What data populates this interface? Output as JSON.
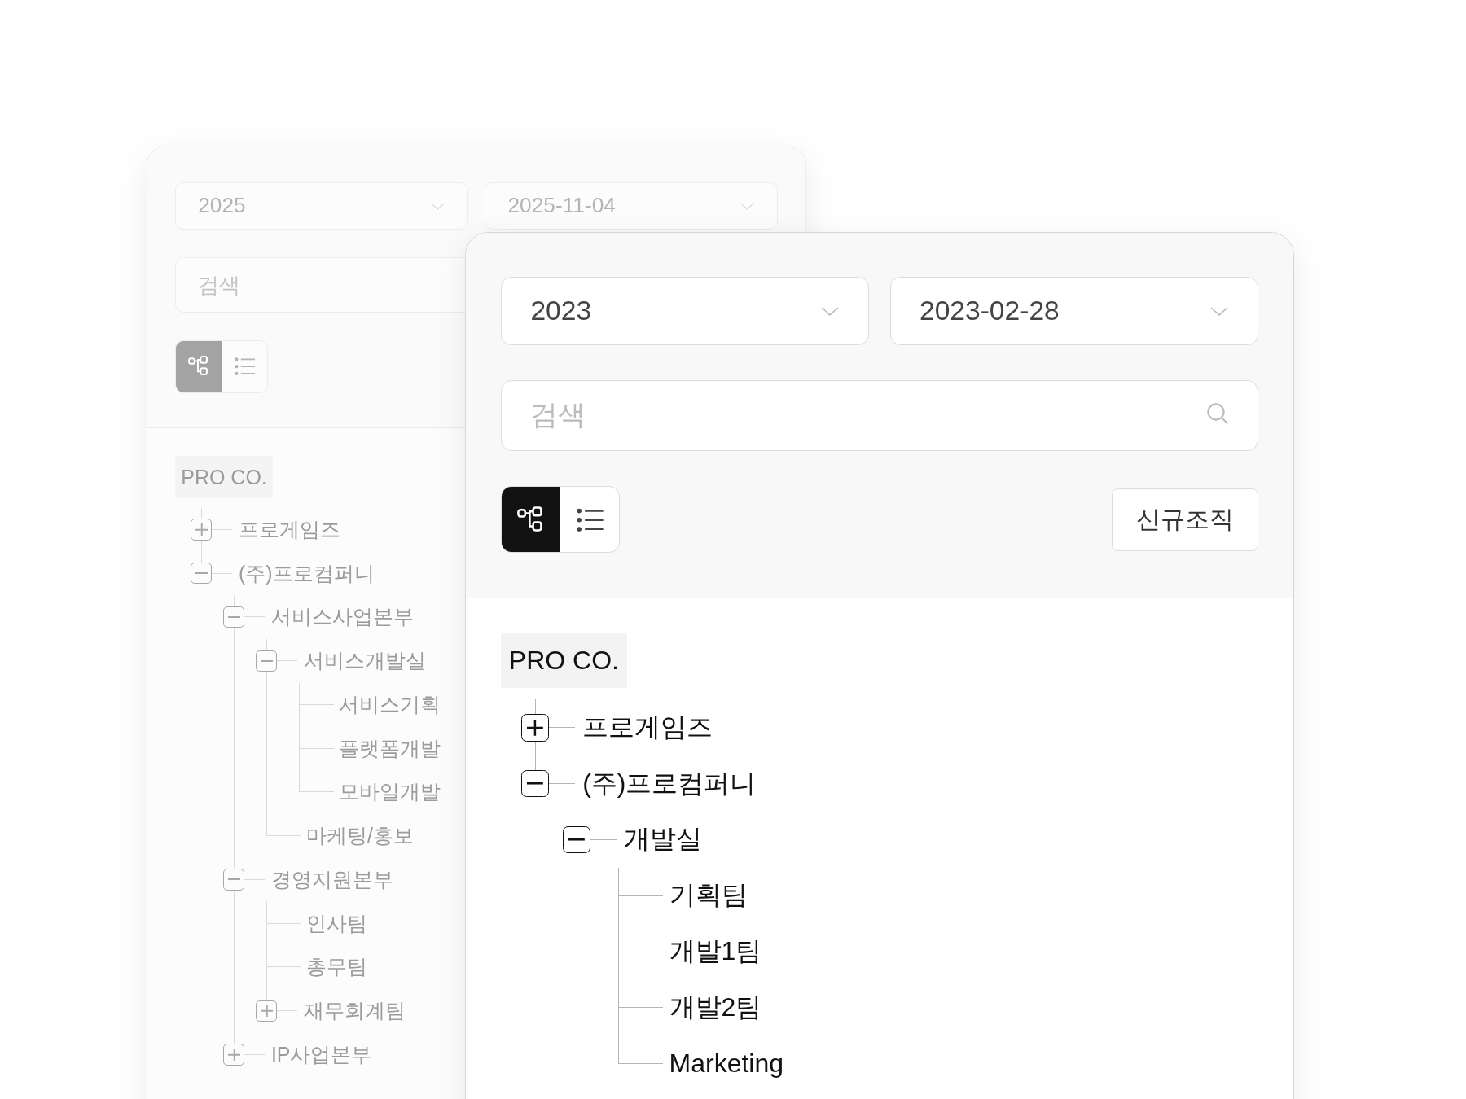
{
  "windows": [
    {
      "active": false,
      "year": {
        "value": "2025"
      },
      "date": {
        "value": "2025-11-04"
      },
      "search": {
        "placeholder": "검색"
      },
      "view_modes": [
        {
          "kind": "tree",
          "selected": true
        },
        {
          "kind": "list",
          "selected": false
        }
      ],
      "tree": {
        "label": "PRO CO.",
        "children": [
          {
            "label": "프로게임즈",
            "expanded": false
          },
          {
            "label": "(주)프로컴퍼니",
            "expanded": true,
            "children": [
              {
                "label": "서비스사업본부",
                "expanded": true,
                "children": [
                  {
                    "label": "서비스개발실",
                    "expanded": true,
                    "children": [
                      {
                        "label": "서비스기획"
                      },
                      {
                        "label": "플랫폼개발"
                      },
                      {
                        "label": "모바일개발"
                      }
                    ]
                  },
                  {
                    "label": "마케팅/홍보"
                  }
                ]
              },
              {
                "label": "경영지원본부",
                "expanded": true,
                "children": [
                  {
                    "label": "인사팀"
                  },
                  {
                    "label": "총무팀"
                  },
                  {
                    "label": "재무회계팀",
                    "expanded": false
                  }
                ]
              },
              {
                "label": "IP사업본부",
                "expanded": false
              }
            ]
          }
        ]
      }
    },
    {
      "active": true,
      "year": {
        "value": "2023"
      },
      "date": {
        "value": "2023-02-28"
      },
      "search": {
        "placeholder": "검색"
      },
      "view_modes": [
        {
          "kind": "tree",
          "selected": true
        },
        {
          "kind": "list",
          "selected": false
        }
      ],
      "new_button": "신규조직",
      "tree": {
        "label": "PRO CO.",
        "children": [
          {
            "label": "프로게임즈",
            "expanded": false
          },
          {
            "label": "(주)프로컴퍼니",
            "expanded": true,
            "children": [
              {
                "label": "개발실",
                "expanded": true,
                "children": [
                  {
                    "label": "기획팀"
                  },
                  {
                    "label": "개발1팀"
                  },
                  {
                    "label": "개발2팀"
                  },
                  {
                    "label": "Marketing"
                  }
                ]
              }
            ]
          }
        ]
      }
    }
  ]
}
